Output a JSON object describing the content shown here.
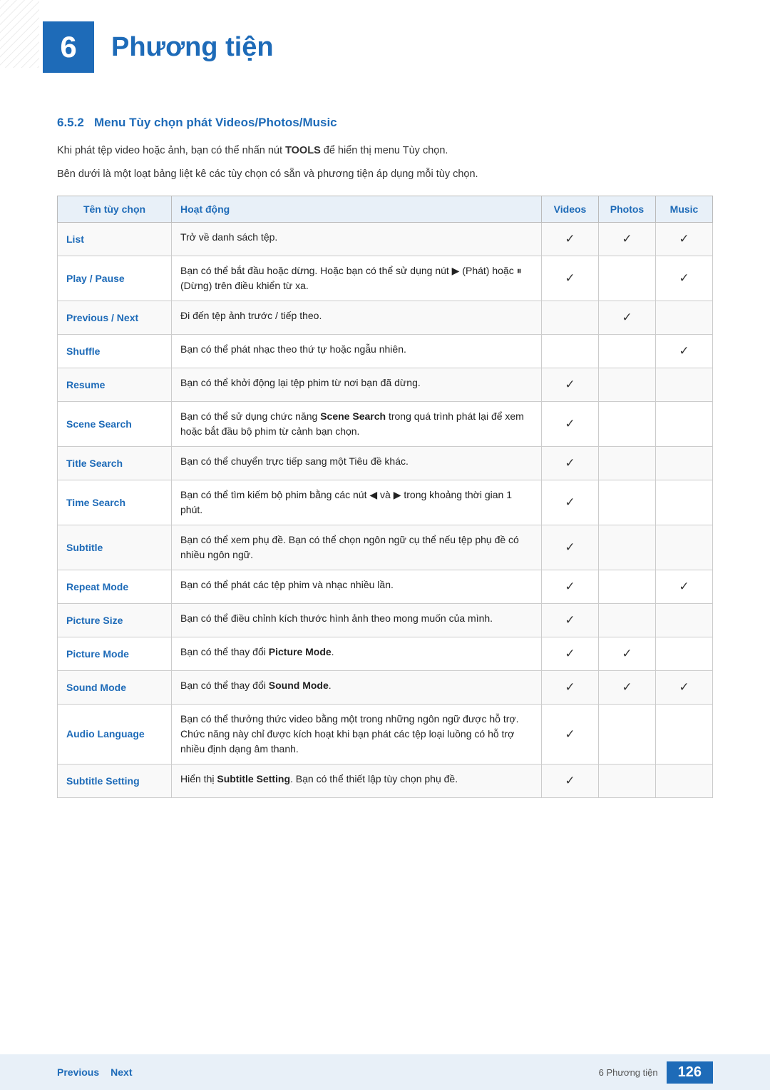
{
  "header": {
    "chapter_number": "6",
    "chapter_title": "Phương tiện"
  },
  "section": {
    "number": "6.5.2",
    "title": "Menu Tùy chọn phát Videos/Photos/Music"
  },
  "intro_lines": [
    "Khi phát tệp video hoặc ảnh, bạn có thể nhấn nút TOOLS để hiển thị menu Tùy chọn.",
    "Bên dưới là một loạt bảng liệt kê các tùy chọn có sẵn và phương tiện áp dụng mỗi tùy chọn."
  ],
  "table": {
    "headers": [
      "Tên tùy chọn",
      "Hoạt động",
      "Videos",
      "Photos",
      "Music"
    ],
    "rows": [
      {
        "name": "List",
        "description": "Trở về danh sách tệp.",
        "videos": true,
        "photos": true,
        "music": true
      },
      {
        "name": "Play / Pause",
        "description": "Bạn có thể bắt đầu hoặc dừng. Hoặc bạn có thể sử dụng nút ▶ (Phát) hoặc ⏸ (Dừng) trên điều khiển từ xa.",
        "videos": true,
        "photos": false,
        "music": true
      },
      {
        "name": "Previous / Next",
        "description": "Đi đến tệp ảnh trước / tiếp theo.",
        "videos": false,
        "photos": true,
        "music": false
      },
      {
        "name": "Shuffle",
        "description": "Bạn có thể phát nhạc theo thứ tự hoặc ngẫu nhiên.",
        "videos": false,
        "photos": false,
        "music": true
      },
      {
        "name": "Resume",
        "description": "Bạn có thể khởi động lại tệp phim từ nơi bạn đã dừng.",
        "videos": true,
        "photos": false,
        "music": false
      },
      {
        "name": "Scene Search",
        "description": "Bạn có thể sử dụng chức năng Scene Search trong quá trình phát lại để xem hoặc bắt đầu bộ phim từ cảnh bạn chọn.",
        "videos": true,
        "photos": false,
        "music": false
      },
      {
        "name": "Title Search",
        "description": "Bạn có thể chuyển trực tiếp sang một Tiêu đề khác.",
        "videos": true,
        "photos": false,
        "music": false
      },
      {
        "name": "Time Search",
        "description": "Bạn có thể tìm kiếm bộ phim bằng các nút ◀ và ▶ trong khoảng thời gian 1 phút.",
        "videos": true,
        "photos": false,
        "music": false
      },
      {
        "name": "Subtitle",
        "description": "Bạn có thể xem phụ đề. Bạn có thể chọn ngôn ngữ cụ thể nếu tệp phụ đề có nhiều ngôn ngữ.",
        "videos": true,
        "photos": false,
        "music": false
      },
      {
        "name": "Repeat Mode",
        "description": "Bạn có thể phát các tệp phim và nhạc nhiều lần.",
        "videos": true,
        "photos": false,
        "music": true
      },
      {
        "name": "Picture Size",
        "description": "Bạn có thể điều chỉnh kích thước hình ảnh theo mong muốn của mình.",
        "videos": true,
        "photos": false,
        "music": false
      },
      {
        "name": "Picture Mode",
        "description": "Bạn có thể thay đổi Picture Mode.",
        "videos": true,
        "photos": true,
        "music": false
      },
      {
        "name": "Sound Mode",
        "description": "Bạn có thể thay đổi Sound Mode.",
        "videos": true,
        "photos": true,
        "music": true
      },
      {
        "name": "Audio Language",
        "description": "Bạn có thể thưởng thức video bằng một trong những ngôn ngữ được hỗ trợ. Chức năng này chỉ được kích hoạt khi bạn phát các tệp loại luồng có hỗ trợ nhiều định dạng âm thanh.",
        "videos": true,
        "photos": false,
        "music": false
      },
      {
        "name": "Subtitle Setting",
        "description": "Hiển thị Subtitle Setting. Bạn có thể thiết lập tùy chọn phụ đề.",
        "videos": true,
        "photos": false,
        "music": false
      }
    ]
  },
  "footer": {
    "previous_label": "Previous",
    "next_label": "Next",
    "chapter_label": "6 Phương tiện",
    "page_number": "126"
  }
}
